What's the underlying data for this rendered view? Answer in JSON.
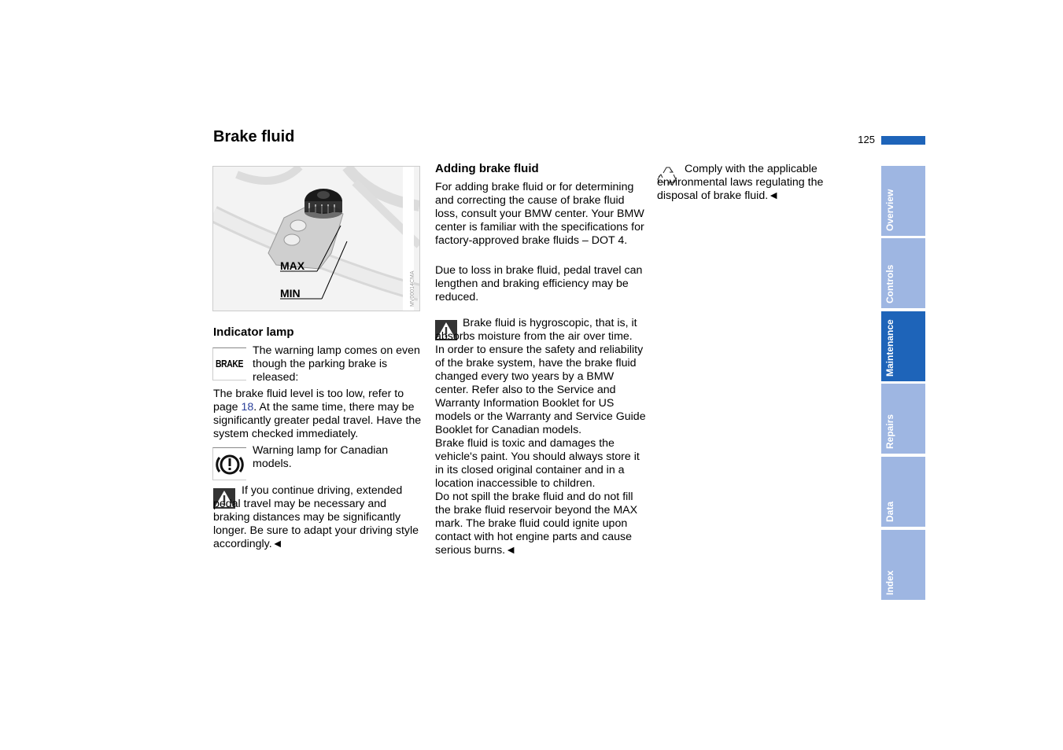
{
  "header": {
    "title": "Brake fluid",
    "page_number": "125"
  },
  "figure": {
    "label_max": "MAX",
    "label_min": "MIN",
    "code": "MV00014CMA"
  },
  "indicator": {
    "heading": "Indicator lamp",
    "brake_icon_text": "BRAKE",
    "lamp_text": "The warning lamp comes on even though the parking brake is released:",
    "level_text_before": "The brake fluid level is too low, refer to page ",
    "level_link": "18",
    "level_text_after": ". At the same time, there may be significantly greater pedal travel. Have the system checked immediately.",
    "canadian_text": "Warning lamp for Canadian models.",
    "warning_text": "If you continue driving, extended pedal travel may be necessary and braking distances may be significantly longer. Be sure to adapt your driving style accordingly.◄"
  },
  "adding": {
    "heading": "Adding brake fluid",
    "para1": "For adding brake fluid or for determining and correcting the cause of brake fluid loss, consult your BMW center. Your BMW center is familiar with the specifications for factory-approved brake fluids – DOT 4.",
    "para2": "Due to loss in brake fluid, pedal travel can lengthen and braking efficiency may be reduced.",
    "warn1": "Brake fluid is hygroscopic, that is, it absorbs moisture from the air over time.",
    "warn2": "In order to ensure the safety and reliability of the brake system, have the brake fluid changed every two years by a BMW center. Refer also to the Service and Warranty Information Booklet for US models or the Warranty and Service Guide Booklet for Canadian models.",
    "warn3": "Brake fluid is toxic and damages the vehicle's paint. You should always store it in its closed original container and in a location inaccessible to children.",
    "warn4": "Do not spill the brake fluid and do not fill the brake fluid reservoir beyond the MAX mark. The brake fluid could ignite upon contact with hot engine parts and cause serious burns.◄"
  },
  "environment": {
    "text": "Comply with the applicable environmental laws regulating the disposal of brake fluid.◄"
  },
  "tabs": [
    {
      "label": "Overview",
      "active": false
    },
    {
      "label": "Controls",
      "active": false
    },
    {
      "label": "Maintenance",
      "active": true
    },
    {
      "label": "Repairs",
      "active": false
    },
    {
      "label": "Data",
      "active": false
    },
    {
      "label": "Index",
      "active": false
    }
  ],
  "colors": {
    "accent": "#1e64b9",
    "tab_inactive": "#9eb6e2",
    "link": "#2a3f9a"
  }
}
